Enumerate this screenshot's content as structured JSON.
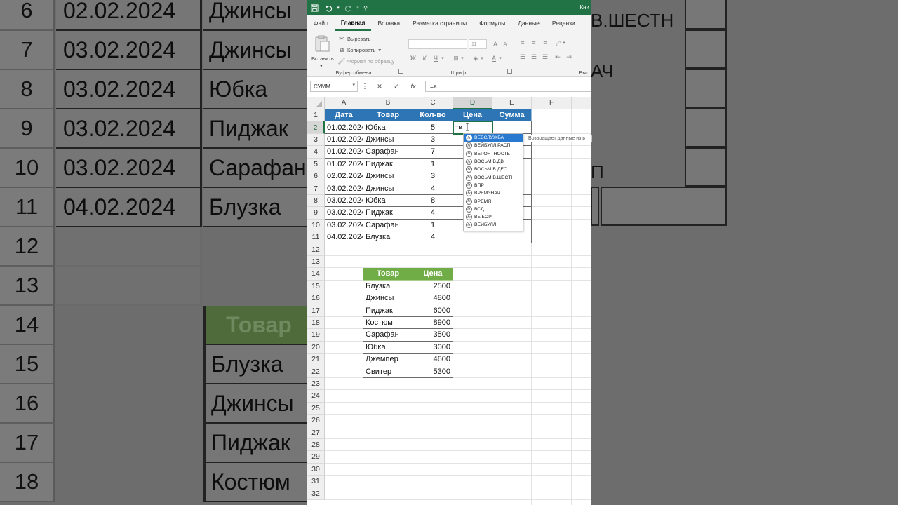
{
  "window": {
    "title": "Кни"
  },
  "ribbon_tabs": [
    "Файл",
    "Главная",
    "Вставка",
    "Разметка страницы",
    "Формулы",
    "Данные",
    "Рецензи"
  ],
  "ribbon": {
    "paste_label": "Вставить",
    "cut_label": "Вырезать",
    "copy_label": "Копировать",
    "format_painter_label": "Формат по образцу",
    "clipboard_group": "Буфер обмена",
    "font_group": "Шрифт",
    "font_size": "11",
    "bold": "Ж",
    "italic": "К",
    "underline": "Ч"
  },
  "formula_bar": {
    "name_box": "СУММ",
    "formula": "=в",
    "fx": "fx"
  },
  "columns": [
    "A",
    "B",
    "C",
    "D",
    "E",
    "F"
  ],
  "rows": [
    "1",
    "2",
    "3",
    "4",
    "5",
    "6",
    "7",
    "8",
    "9",
    "10",
    "11",
    "12",
    "13",
    "14",
    "15",
    "16",
    "17",
    "18",
    "19",
    "20",
    "21",
    "22",
    "23",
    "24",
    "25",
    "26",
    "27",
    "28",
    "29",
    "30",
    "31",
    "32"
  ],
  "sales_table": {
    "headers": [
      "Дата",
      "Товар",
      "Кол-во",
      "Цена",
      "Сумма"
    ],
    "rows": [
      [
        "01.02.2024",
        "Юбка",
        "5"
      ],
      [
        "01.02.2024",
        "Джинсы",
        "3"
      ],
      [
        "01.02.2024",
        "Сарафан",
        "7"
      ],
      [
        "01.02.2024",
        "Пиджак",
        "1"
      ],
      [
        "02.02.2024",
        "Джинсы",
        "3"
      ],
      [
        "03.02.2024",
        "Джинсы",
        "4"
      ],
      [
        "03.02.2024",
        "Юбка",
        "8"
      ],
      [
        "03.02.2024",
        "Пиджак",
        "4"
      ],
      [
        "03.02.2024",
        "Сарафан",
        "1"
      ],
      [
        "04.02.2024",
        "Блузка",
        "4"
      ]
    ]
  },
  "price_table": {
    "headers": [
      "Товар",
      "Цена"
    ],
    "rows": [
      [
        "Блузка",
        "2500"
      ],
      [
        "Джинсы",
        "4800"
      ],
      [
        "Пиджак",
        "6000"
      ],
      [
        "Костюм",
        "8900"
      ],
      [
        "Сарафан",
        "3500"
      ],
      [
        "Юбка",
        "3000"
      ],
      [
        "Джемпер",
        "4600"
      ],
      [
        "Свитер",
        "5300"
      ]
    ]
  },
  "edit_cell_text": "=в",
  "autocomplete": {
    "items": [
      "ВЕБСЛУЖБА",
      "ВЕЙБУЛЛ.РАСП",
      "ВЕРОЯТНОСТЬ",
      "ВОСЬМ.В.ДВ",
      "ВОСЬМ.В.ДЕС",
      "ВОСЬМ.В.ШЕСТН",
      "ВПР",
      "ВРЕМЗНАЧ",
      "ВРЕМЯ",
      "ВСД",
      "ВЫБОР",
      "ВЕЙБУЛЛ"
    ],
    "selected_index": 0,
    "tooltip": "Возвращает данные из в"
  },
  "background": {
    "rows": [
      {
        "num": "6",
        "a": "02.02.2024",
        "b": "Джинсы"
      },
      {
        "num": "7",
        "a": "03.02.2024",
        "b": "Джинсы"
      },
      {
        "num": "8",
        "a": "03.02.2024",
        "b": "Юбка"
      },
      {
        "num": "9",
        "a": "03.02.2024",
        "b": "Пиджак"
      },
      {
        "num": "10",
        "a": "03.02.2024",
        "b": "Сарафан"
      },
      {
        "num": "11",
        "a": "04.02.2024",
        "b": "Блузка"
      },
      {
        "num": "12",
        "a": "",
        "b": ""
      },
      {
        "num": "13",
        "a": "",
        "b": ""
      },
      {
        "num": "14",
        "a": "",
        "b": "Товар"
      },
      {
        "num": "15",
        "a": "",
        "b": "Блузка"
      },
      {
        "num": "16",
        "a": "",
        "b": "Джинсы"
      },
      {
        "num": "17",
        "a": "",
        "b": "Пиджак"
      },
      {
        "num": "18",
        "a": "",
        "b": "Костюм"
      }
    ],
    "right_texts": [
      "В.ШЕСТН",
      "АЧ",
      "П"
    ]
  },
  "colors": {
    "excel_green": "#217346",
    "header_blue": "#2e75b6",
    "header_green": "#70ad47"
  }
}
